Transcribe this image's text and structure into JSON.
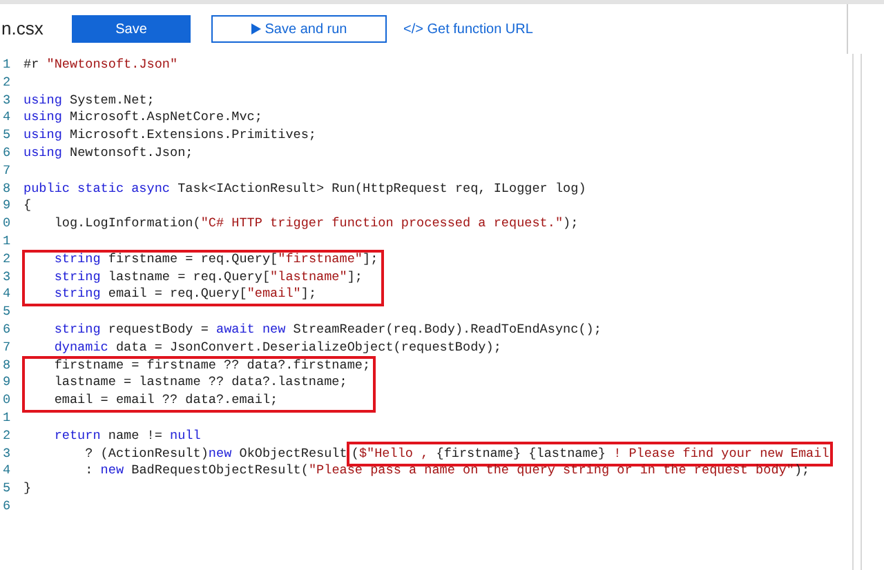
{
  "file_name": "n.csx",
  "toolbar": {
    "save": "Save",
    "save_and_run": "Save and run",
    "function_url_link": "</> Get function URL"
  },
  "editor": {
    "blocks": [
      {
        "boxed": false,
        "lines": [
          {
            "number": "1",
            "tokens": [
              {
                "kind": "plain",
                "text": "#r "
              },
              {
                "kind": "string",
                "text": "\"Newtonsoft.Json\""
              }
            ]
          },
          {
            "number": "2"
          },
          {
            "number": "3",
            "tokens": [
              {
                "kind": "keyword",
                "text": "using"
              },
              {
                "kind": "plain",
                "text": " System.Net;"
              }
            ]
          },
          {
            "number": "4",
            "tokens": [
              {
                "kind": "keyword",
                "text": "using"
              },
              {
                "kind": "plain",
                "text": " Microsoft.AspNetCore.Mvc;"
              }
            ]
          },
          {
            "number": "5",
            "tokens": [
              {
                "kind": "keyword",
                "text": "using"
              },
              {
                "kind": "plain",
                "text": " Microsoft.Extensions.Primitives;"
              }
            ]
          },
          {
            "number": "6",
            "tokens": [
              {
                "kind": "keyword",
                "text": "using"
              },
              {
                "kind": "plain",
                "text": " Newtonsoft.Json;"
              }
            ]
          },
          {
            "number": "7"
          },
          {
            "number": "8",
            "tokens": [
              {
                "kind": "keyword",
                "text": "public static async"
              },
              {
                "kind": "plain",
                "text": " Task<IActionResult> Run(HttpRequest req, ILogger log)"
              }
            ]
          },
          {
            "number": "9",
            "tokens": [
              {
                "kind": "plain",
                "text": "{"
              }
            ]
          },
          {
            "number": "0",
            "tokens": [
              {
                "kind": "plain",
                "text": "    log.LogInformation("
              },
              {
                "kind": "string",
                "text": "\"C# HTTP trigger function processed a request.\""
              },
              {
                "kind": "plain",
                "text": ");"
              }
            ]
          },
          {
            "number": "1"
          }
        ]
      },
      {
        "boxed": true,
        "lines": [
          {
            "number": "2",
            "tokens": [
              {
                "kind": "keyword",
                "text": "    string"
              },
              {
                "kind": "plain",
                "text": " firstname = req.Query["
              },
              {
                "kind": "string",
                "text": "\"firstname\""
              },
              {
                "kind": "plain",
                "text": "];"
              }
            ]
          },
          {
            "number": "3",
            "tokens": [
              {
                "kind": "keyword",
                "text": "    string"
              },
              {
                "kind": "plain",
                "text": " lastname = req.Query["
              },
              {
                "kind": "string",
                "text": "\"lastname\""
              },
              {
                "kind": "plain",
                "text": "];"
              }
            ]
          },
          {
            "number": "4",
            "tokens": [
              {
                "kind": "keyword",
                "text": "    string"
              },
              {
                "kind": "plain",
                "text": " email = req.Query["
              },
              {
                "kind": "string",
                "text": "\"email\""
              },
              {
                "kind": "plain",
                "text": "];"
              }
            ]
          }
        ]
      },
      {
        "boxed": false,
        "lines": [
          {
            "number": "5"
          },
          {
            "number": "6",
            "tokens": [
              {
                "kind": "keyword",
                "text": "    string"
              },
              {
                "kind": "plain",
                "text": " requestBody = "
              },
              {
                "kind": "keyword",
                "text": "await new"
              },
              {
                "kind": "plain",
                "text": " StreamReader(req.Body).ReadToEndAsync();"
              }
            ]
          },
          {
            "number": "7",
            "tokens": [
              {
                "kind": "keyword",
                "text": "    dynamic"
              },
              {
                "kind": "plain",
                "text": " data = JsonConvert.DeserializeObject(requestBody);"
              }
            ]
          }
        ]
      },
      {
        "boxed": true,
        "lines": [
          {
            "number": "8",
            "tokens": [
              {
                "kind": "plain",
                "text": "    firstname = firstname ?? data?.firstname;"
              }
            ]
          },
          {
            "number": "9",
            "tokens": [
              {
                "kind": "plain",
                "text": "    lastname = lastname ?? data?.lastname;"
              }
            ]
          },
          {
            "number": "0",
            "tokens": [
              {
                "kind": "plain",
                "text": "    email = email ?? data?.email;"
              }
            ]
          }
        ]
      },
      {
        "boxed": false,
        "lines": [
          {
            "number": "1"
          },
          {
            "number": "2",
            "tokens": [
              {
                "kind": "keyword",
                "text": "    return"
              },
              {
                "kind": "plain",
                "text": " name != "
              },
              {
                "kind": "keyword",
                "text": "null"
              }
            ]
          },
          {
            "number": "3",
            "tokens": [
              {
                "kind": "plain",
                "text": "        ? (ActionResult)"
              },
              {
                "kind": "keyword",
                "text": "new"
              },
              {
                "kind": "plain",
                "text": " OkObjectResult"
              },
              {
                "kind": "plain",
                "text": "(",
                "boxed": true
              },
              {
                "kind": "string",
                "text": "$\"Hello , ",
                "boxed": true
              },
              {
                "kind": "plain",
                "text": "{firstname} {lastname}",
                "boxed": true
              },
              {
                "kind": "string",
                "text": " ! Please find your new Email",
                "boxed": true
              }
            ]
          },
          {
            "number": "4",
            "tokens": [
              {
                "kind": "plain",
                "text": "        : "
              },
              {
                "kind": "keyword",
                "text": "new"
              },
              {
                "kind": "plain",
                "text": " BadRequestObjectResult("
              },
              {
                "kind": "string",
                "text": "\"Please pass a name on the query string or in the request body\""
              },
              {
                "kind": "plain",
                "text": ");"
              }
            ]
          },
          {
            "number": "5",
            "tokens": [
              {
                "kind": "plain",
                "text": "}"
              }
            ]
          },
          {
            "number": "6"
          }
        ]
      }
    ]
  }
}
